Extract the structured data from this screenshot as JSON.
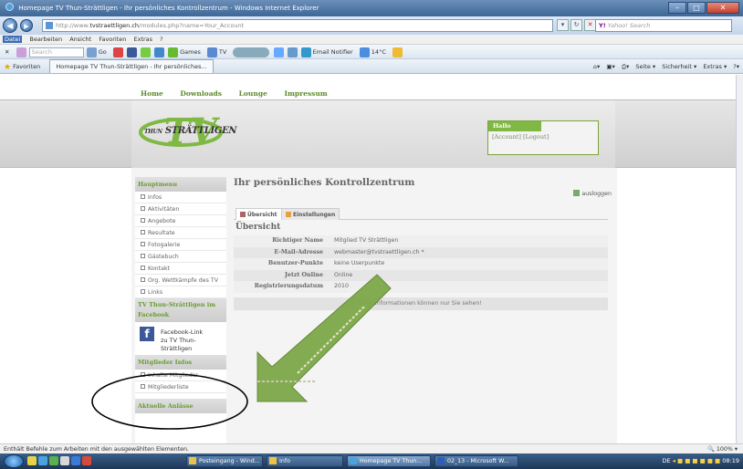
{
  "window": {
    "title": "Homepage TV Thun-Strättligen - Ihr persönliches Kontrollzentrum - Windows Internet Explorer",
    "buttons": {
      "minimize": "–",
      "maximize": "□",
      "close": "✕"
    }
  },
  "addressbar": {
    "url_prefix": "http://www.",
    "url_domain": "tvstraettligen.ch",
    "url_path": "/modules.php?name=Your_Account",
    "search_placeholder": "Yahoo! Search",
    "search_logo": "Y!"
  },
  "menubar": [
    "Datei",
    "Bearbeiten",
    "Ansicht",
    "Favoriten",
    "Extras",
    "?"
  ],
  "toolbar": {
    "search_placeholder": "Search",
    "go_label": "Go",
    "games_label": "Games",
    "tv_label": "TV",
    "email_label": "Email Notifier",
    "temp_label": "14°C"
  },
  "favorites": {
    "favorites_label": "Favoriten",
    "tab_label": "Homepage TV Thun-Strättligen - Ihr persönliches...",
    "right_items": [
      "Seite ▾",
      "Sicherheit ▾",
      "Extras ▾"
    ]
  },
  "site": {
    "nav": [
      "Home",
      "Downloads",
      "Lounge",
      "Impressum"
    ],
    "logo_prefix": "THUN",
    "logo_main": "STRÄTTLIGEN",
    "hallo_title": "Hallo",
    "hallo_links": "[Account] [Logout]"
  },
  "sidebar": {
    "main_heading": "Hauptmenu",
    "items": [
      "Infos",
      "Aktivitäten",
      "Angebote",
      "Resultate",
      "Fotogalerie",
      "Gästebuch",
      "Kontakt",
      "Org. Wettkämpfe des TV",
      "Links"
    ],
    "fb_heading": "TV Thun-Strättligen im Facebook",
    "fb_link": "Facebook-Link",
    "fb_link2": "zu TV Thun-Strättligen",
    "member_heading": "Mitglieder Infos",
    "member_items": [
      "Inhalte Mitglieder",
      "Mitgliederliste"
    ],
    "news_heading": "Aktuelle Anlässe"
  },
  "main": {
    "title": "Ihr persönliches Kontrollzentrum",
    "logout_label": "ausloggen",
    "tabs": [
      "Übersicht",
      "Einstellungen"
    ],
    "section": "Übersicht",
    "rows": [
      {
        "k": "Richtiger Name",
        "v": "Mitglied TV Strättligen"
      },
      {
        "k": "E-Mail-Adresse",
        "v": "webmaster@tvstraettligen.ch *"
      },
      {
        "k": "Benutzer-Punkte",
        "v": "keine Userpunkte"
      },
      {
        "k": "Jetzt Online",
        "v": "Online"
      },
      {
        "k": "Registrierungsdatum",
        "v": "2010"
      }
    ],
    "note": "* Diese Informationen können nur Sie sehen!"
  },
  "statusbar": {
    "text": "Enthält Befehle zum Arbeiten mit den ausgewählten Elementen.",
    "zoom": "100%"
  },
  "taskbar": {
    "tasks": [
      "Posteingang - Wind...",
      "Info",
      "Homepage TV Thun...",
      "02_13 - Microsoft W..."
    ],
    "tray_lang": "DE",
    "tray_time": "08:19"
  },
  "colors": {
    "accent_green": "#7fb843",
    "arrow_green": "#7ea84a",
    "ie_blue": "#3e6798"
  }
}
